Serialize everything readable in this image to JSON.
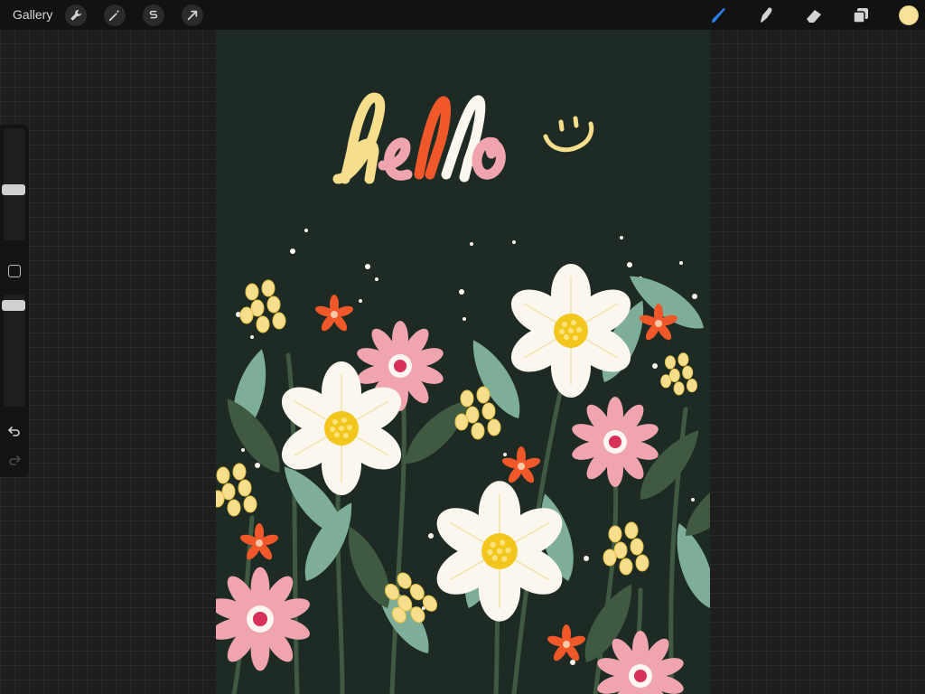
{
  "topbar": {
    "gallery_label": "Gallery",
    "left_tools": [
      "wrench-icon",
      "magic-wand-icon",
      "selection-icon",
      "transform-arrow-icon"
    ],
    "right_tools": [
      "brush-icon",
      "smudge-icon",
      "eraser-icon",
      "layers-icon"
    ],
    "active_tool": "brush-icon",
    "accent_color": "#2d7fe8",
    "current_color": "#f7e29a"
  },
  "sidebar": {
    "brush_size_level": 0.55,
    "opacity_level": 0.05,
    "controls": [
      "brush-size-slider",
      "modify-button",
      "opacity-slider",
      "undo-button",
      "redo-button"
    ]
  },
  "artwork": {
    "lettering": "hello",
    "background_color": "#1d2b24",
    "palette": [
      "#f6de8c",
      "#f0582a",
      "#fbf7ee",
      "#f0a4ad",
      "#7fae98",
      "#3f5a40"
    ]
  }
}
